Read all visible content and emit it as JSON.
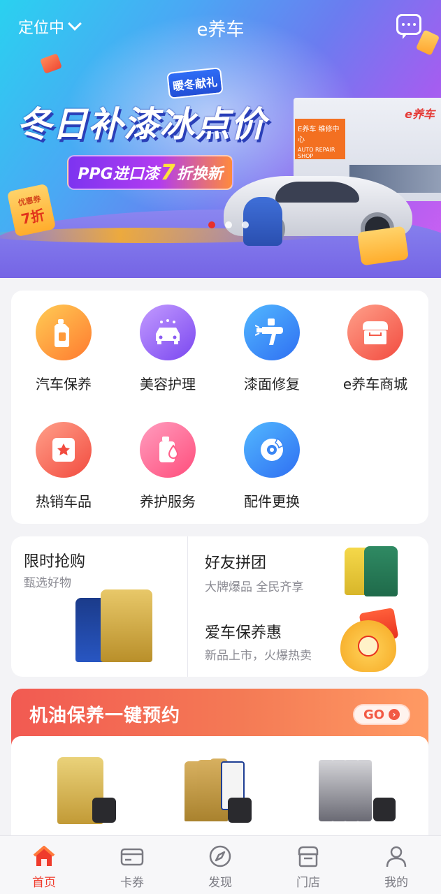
{
  "header": {
    "location_label": "定位中",
    "app_title": "e养车"
  },
  "banner": {
    "badge": "暖冬献礼",
    "headline": "冬日补漆冰点价",
    "pill_prefix": "PPG进口漆",
    "pill_number": "7",
    "pill_suffix": "折换新",
    "coupon_top": "优惠券",
    "coupon_value": "7折",
    "store_sign_line1": "E养车 维修中心",
    "store_sign_line2": "AUTO REPAIR SHOP",
    "store_logo": "e养车",
    "slide_count": 3,
    "active_slide": 1
  },
  "categories": [
    {
      "label": "汽车保养",
      "icon": "oil-bottle-icon",
      "color": "#ff8a2f"
    },
    {
      "label": "美容护理",
      "icon": "car-wash-icon",
      "color": "#7a47f0"
    },
    {
      "label": "漆面修复",
      "icon": "spray-gun-icon",
      "color": "#2f6ff2"
    },
    {
      "label": "e养车商城",
      "icon": "store-icon",
      "color": "#f24b3f"
    },
    {
      "label": "热销车品",
      "icon": "star-bag-icon",
      "color": "#f24b3f"
    },
    {
      "label": "养护服务",
      "icon": "fluid-bottle-icon",
      "color": "#ff4d7b"
    },
    {
      "label": "配件更换",
      "icon": "brake-disc-icon",
      "color": "#2f6ff2"
    }
  ],
  "promos": {
    "flash_sale": {
      "title": "限时抢购",
      "subtitle": "甄选好物"
    },
    "group_buy": {
      "title": "好友拼团",
      "subtitle": "大牌爆品 全民齐享"
    },
    "care_deal": {
      "title": "爱车保养惠",
      "subtitle": "新品上市，火爆热卖"
    }
  },
  "oil_booking": {
    "title": "机油保养一键预约",
    "go_label": "GO",
    "products": [
      "castrol-edge-oil",
      "mobil-1-oil",
      "schaeffler-oil"
    ]
  },
  "tabbar": [
    {
      "label": "首页",
      "icon": "home-icon",
      "active": true
    },
    {
      "label": "卡券",
      "icon": "card-icon",
      "active": false
    },
    {
      "label": "发现",
      "icon": "compass-icon",
      "active": false
    },
    {
      "label": "门店",
      "icon": "store-icon",
      "active": false
    },
    {
      "label": "我的",
      "icon": "profile-icon",
      "active": false
    }
  ],
  "colors": {
    "accent": "#ef3b2c",
    "tab_inactive": "#7a7a82"
  }
}
